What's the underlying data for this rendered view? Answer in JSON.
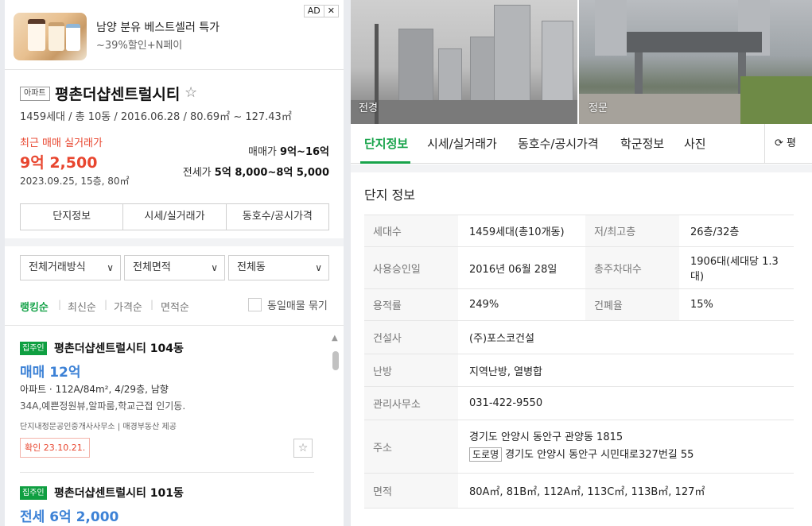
{
  "ad": {
    "badge": "AD",
    "close": "✕",
    "title": "남양 분유 베스트셀러 특가",
    "subtitle": "~39%할인+N페이"
  },
  "summary": {
    "type_tag": "아파트",
    "name": "평촌더샵센트럴시티",
    "star": "☆",
    "meta": "1459세대 / 총 10동 / 2016.06.28 / 80.69㎡ ~ 127.43㎡",
    "recent_label": "최근 매매 실거래가",
    "recent_price": "9억 2,500",
    "recent_date": "2023.09.25, 15층, 80㎡",
    "sale_label": "매매가",
    "sale_range": "9억~16억",
    "jeonse_label": "전세가",
    "jeonse_range": "5억 8,000~8억 5,000",
    "tabs": [
      "단지정보",
      "시세/실거래가",
      "동호수/공시가격"
    ]
  },
  "filters": {
    "trade_type": "전체거래방식",
    "area": "전체면적",
    "dong": "전체동",
    "sort": [
      "랭킹순",
      "최신순",
      "가격순",
      "면적순"
    ],
    "dup_label": "동일매물 묶기"
  },
  "listings": [
    {
      "tag": "집주인",
      "name": "평촌더샵센트럴시티 104동",
      "price": "매매 12억",
      "spec": "아파트 · 112A/84m², 4/29층, 남향",
      "desc": "34A,예쁜정원뷰,알파룸,학교근접 인기동.",
      "agent": "단지내정문공인중개사사무소 | 매경부동산 제공",
      "confirm": "확인 23.10.21."
    },
    {
      "tag": "집주인",
      "name": "평촌더샵센트럴시티 101동",
      "price": "전세 6억 2,000",
      "spec": "",
      "desc": "",
      "agent": "",
      "confirm": ""
    }
  ],
  "photos": {
    "left_label": "전경",
    "right_label": "정문"
  },
  "right_tabs": {
    "items": [
      "단지정보",
      "시세/실거래가",
      "동호수/공시가격",
      "학군정보",
      "사진"
    ],
    "refresh": "⟳ 평"
  },
  "section_title": "단지 정보",
  "info": [
    {
      "k1": "세대수",
      "v1": "1459세대(총10개동)",
      "k2": "저/최고층",
      "v2": "26층/32층"
    },
    {
      "k1": "사용승인일",
      "v1": "2016년 06월 28일",
      "k2": "총주차대수",
      "v2": "1906대(세대당 1.3대)"
    },
    {
      "k1": "용적률",
      "v1": "249%",
      "k2": "건폐율",
      "v2": "15%"
    },
    {
      "k1": "건설사",
      "v1": "(주)포스코건설"
    },
    {
      "k1": "난방",
      "v1": "지역난방, 열병합"
    },
    {
      "k1": "관리사무소",
      "v1": "031-422-9550"
    },
    {
      "k1": "주소",
      "v1": "경기도 안양시 동안구 관양동 1815",
      "road_tag": "도로명",
      "v1b": "경기도 안양시 동안구 시민대로327번길 55"
    },
    {
      "k1": "면적",
      "v1": "80A㎡, 81B㎡, 112A㎡, 113C㎡, 113B㎡, 127㎡"
    }
  ]
}
